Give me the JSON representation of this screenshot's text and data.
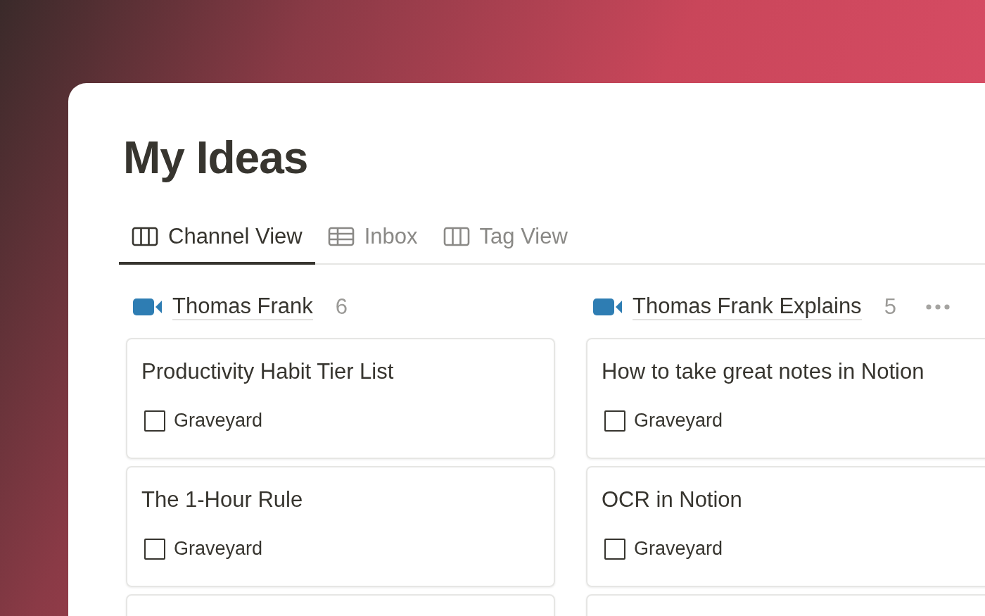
{
  "page": {
    "title": "My Ideas"
  },
  "tabs": [
    {
      "label": "Channel View",
      "kind": "board",
      "selected": true
    },
    {
      "label": "Inbox",
      "kind": "table",
      "selected": false
    },
    {
      "label": "Tag View",
      "kind": "board",
      "selected": false
    }
  ],
  "columns": [
    {
      "name": "Thomas Frank",
      "count": "6",
      "menu": false,
      "cards": [
        {
          "kind": "card",
          "title": "Productivity Habit Tier List",
          "property": "Graveyard",
          "checked": false
        },
        {
          "kind": "card",
          "title": "The 1-Hour Rule",
          "property": "Graveyard",
          "checked": false
        },
        {
          "kind": "cut"
        }
      ]
    },
    {
      "name": "Thomas Frank Explains",
      "count": "5",
      "menu": true,
      "cards": [
        {
          "kind": "card",
          "title": "How to take great notes in Notion",
          "property": "Graveyard",
          "checked": false
        },
        {
          "kind": "card",
          "title": "OCR in Notion",
          "property": "Graveyard",
          "checked": false
        },
        {
          "kind": "cut"
        }
      ]
    }
  ]
}
